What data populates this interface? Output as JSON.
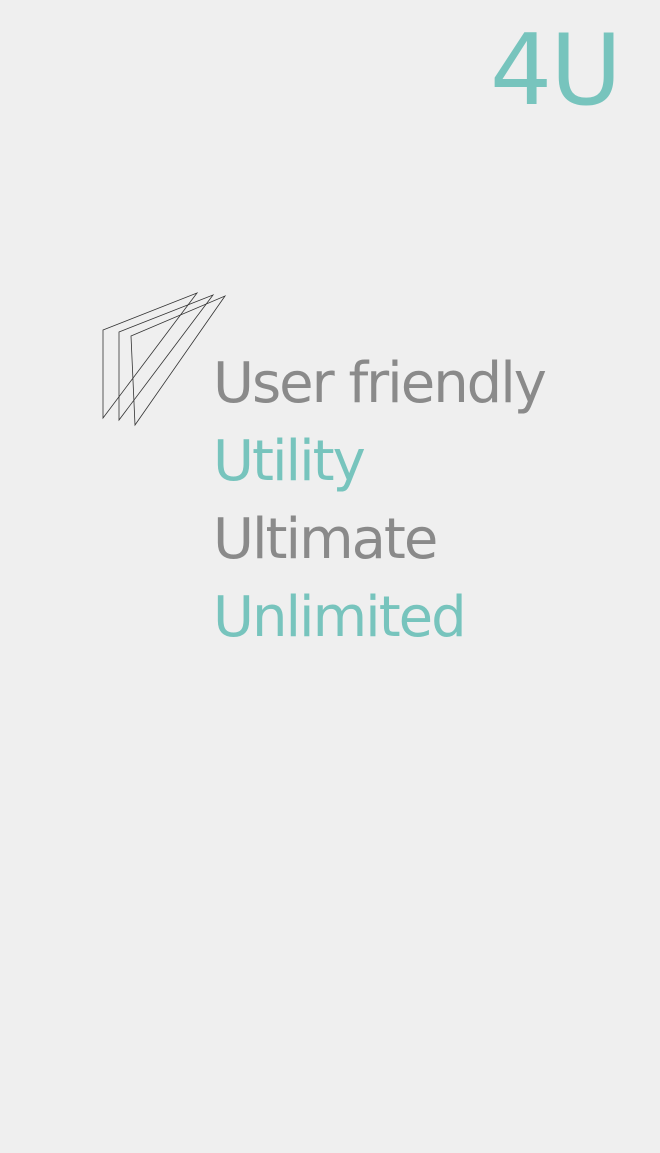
{
  "brand": {
    "logo_text": "4U",
    "logo_icon": "stacked-triangles-icon"
  },
  "taglines": [
    {
      "text": "User friendly",
      "color": "#8a8a8a"
    },
    {
      "text": "Utility",
      "color": "#77c4bd"
    },
    {
      "text": "Ultimate",
      "color": "#8a8a8a"
    },
    {
      "text": "Unlimited",
      "color": "#77c4bd"
    }
  ],
  "colors": {
    "background": "#efefef",
    "accent": "#77c4bd",
    "text_gray": "#8a8a8a",
    "line": "#333333"
  }
}
